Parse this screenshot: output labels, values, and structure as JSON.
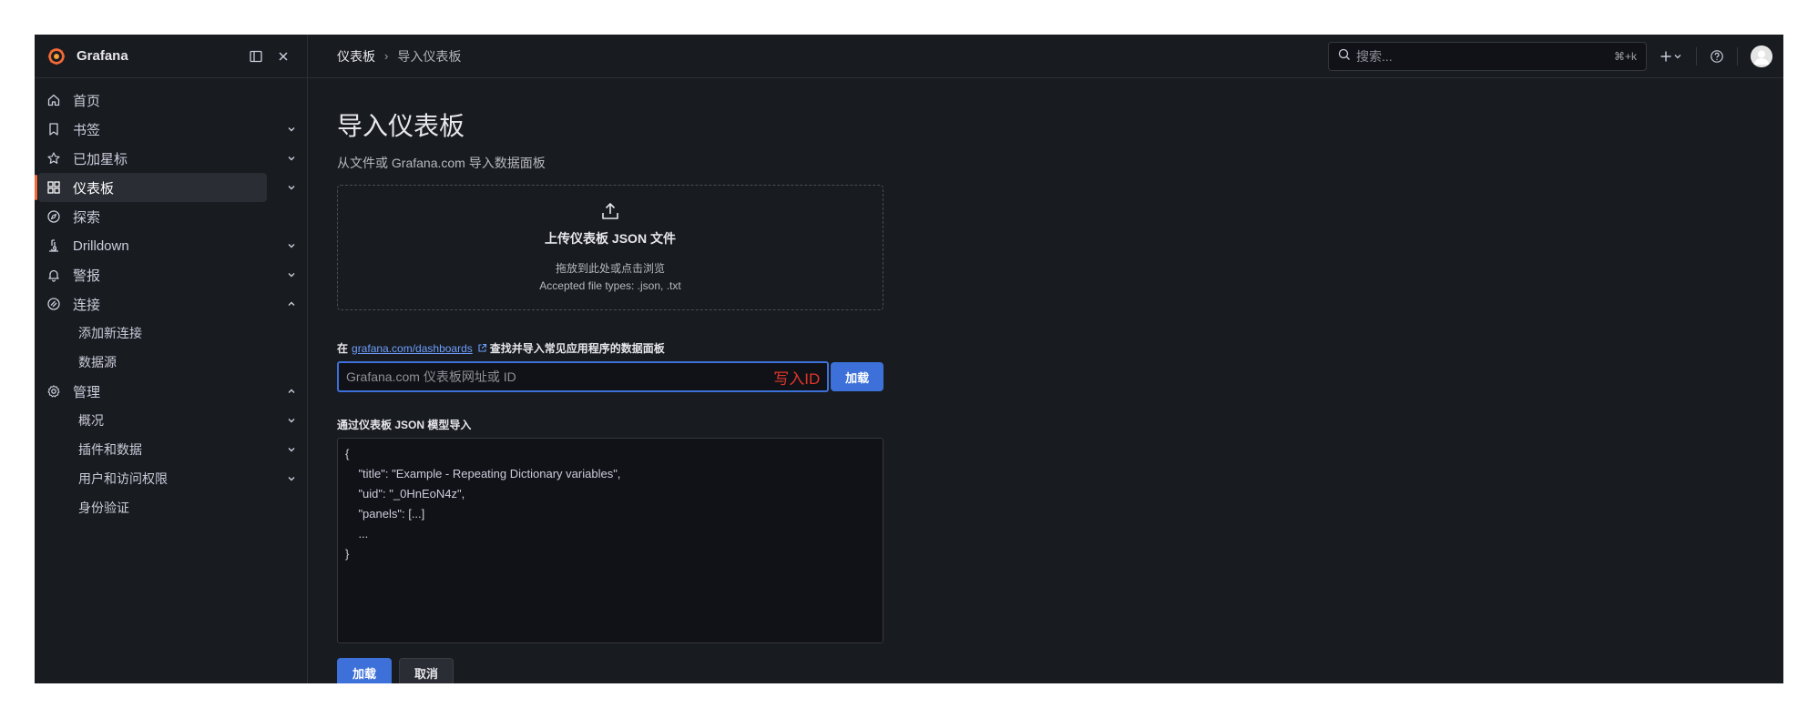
{
  "brand": {
    "name": "Grafana",
    "accent": "#f46a39"
  },
  "nav": {
    "items": [
      {
        "label": "首页",
        "icon": "home-icon"
      },
      {
        "label": "书签",
        "icon": "bookmark-icon"
      },
      {
        "label": "已加星标",
        "icon": "star-icon"
      },
      {
        "label": "仪表板",
        "icon": "apps-icon",
        "active": true
      },
      {
        "label": "探索",
        "icon": "compass-icon"
      },
      {
        "label": "Drilldown",
        "icon": "drilldown-icon"
      },
      {
        "label": "警报",
        "icon": "bell-icon"
      },
      {
        "label": "连接",
        "icon": "link-icon",
        "expanded": true
      },
      {
        "label": "管理",
        "icon": "cog-icon",
        "expanded": true
      }
    ],
    "connections_sub": [
      "添加新连接",
      "数据源"
    ],
    "admin_sub": [
      "概况",
      "插件和数据",
      "用户和访问权限",
      "身份验证"
    ]
  },
  "breadcrumb": {
    "parent": "仪表板",
    "sep": "›",
    "current": "导入仪表板"
  },
  "search": {
    "placeholder": "搜索...",
    "shortcut": "⌘+k"
  },
  "page": {
    "title": "导入仪表板",
    "subtitle": "从文件或 Grafana.com 导入数据面板"
  },
  "upload": {
    "title": "上传仪表板 JSON 文件",
    "hint": "拖放到此处或点击浏览",
    "accepted": "Accepted file types: .json, .txt"
  },
  "grafana_com": {
    "prefix": "在",
    "link": "grafana.com/dashboards",
    "suffix": "查找并导入常见应用程序的数据面板",
    "placeholder": "Grafana.com 仪表板网址或 ID",
    "annotation": "写入ID",
    "load_label": "加载"
  },
  "json_model": {
    "label": "通过仪表板 JSON 模型导入",
    "placeholder": "{\n    \"title\": \"Example - Repeating Dictionary variables\",\n    \"uid\": \"_0HnEoN4z\",\n    \"panels\": [...]\n    ...\n}"
  },
  "actions": {
    "load": "加载",
    "cancel": "取消"
  }
}
